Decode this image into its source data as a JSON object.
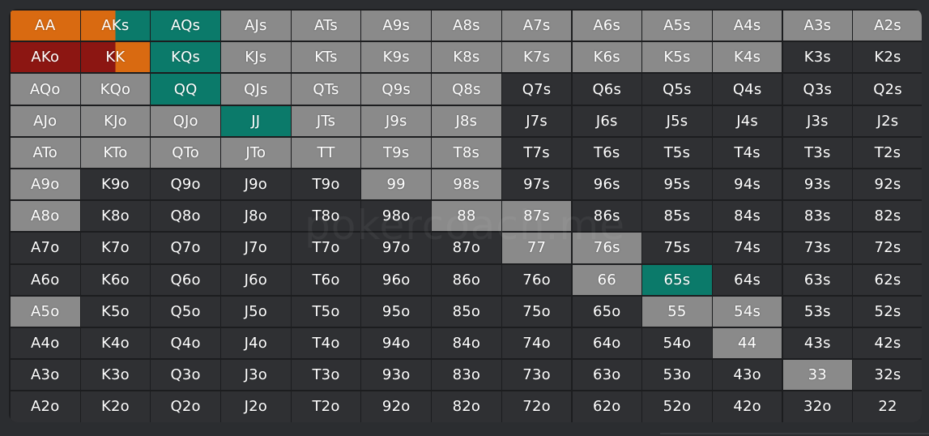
{
  "colors": {
    "background": "#2b2d30",
    "frame": "#1c1d1f",
    "dark": "#2f3033",
    "light": "#8a8a8a",
    "orange": "#d96a11",
    "dark_red": "#8c1612",
    "teal": "#0b7a6a"
  },
  "ranks": [
    "A",
    "K",
    "Q",
    "J",
    "T",
    "9",
    "8",
    "7",
    "6",
    "5",
    "4",
    "3",
    "2"
  ],
  "watermark": "pokercoach.me",
  "legend": {
    "L": "light",
    "D": "dark",
    "O": "orange",
    "R": "dark_red",
    "G": "teal",
    "LG": "light/teal split",
    "OG": "orange/teal split",
    "RO": "dark_red/orange split"
  },
  "grid": [
    [
      "O",
      "OG",
      "G",
      "L",
      "L",
      "L",
      "L",
      "L",
      "L",
      "L",
      "L",
      "L",
      "L"
    ],
    [
      "R",
      "RO",
      "G",
      "L",
      "L",
      "L",
      "L",
      "L",
      "L",
      "L",
      "L",
      "D",
      "D"
    ],
    [
      "L",
      "L",
      "G",
      "L",
      "L",
      "L",
      "L",
      "D",
      "D",
      "D",
      "D",
      "D",
      "D"
    ],
    [
      "L",
      "L",
      "L",
      "G",
      "L",
      "L",
      "L",
      "D",
      "D",
      "D",
      "D",
      "D",
      "D"
    ],
    [
      "L",
      "L",
      "L",
      "L",
      "L",
      "L",
      "L",
      "D",
      "D",
      "D",
      "D",
      "D",
      "D"
    ],
    [
      "L",
      "D",
      "D",
      "D",
      "D",
      "L",
      "L",
      "D",
      "D",
      "D",
      "D",
      "D",
      "D"
    ],
    [
      "L",
      "D",
      "D",
      "D",
      "D",
      "D",
      "L",
      "L",
      "D",
      "D",
      "D",
      "D",
      "D"
    ],
    [
      "D",
      "D",
      "D",
      "D",
      "D",
      "D",
      "D",
      "L",
      "L",
      "D",
      "D",
      "D",
      "D"
    ],
    [
      "D",
      "D",
      "D",
      "D",
      "D",
      "D",
      "D",
      "D",
      "L",
      "G",
      "D",
      "D",
      "D"
    ],
    [
      "L",
      "D",
      "D",
      "D",
      "D",
      "D",
      "D",
      "D",
      "D",
      "L",
      "L",
      "D",
      "D"
    ],
    [
      "D",
      "D",
      "D",
      "D",
      "D",
      "D",
      "D",
      "D",
      "D",
      "D",
      "L",
      "D",
      "D"
    ],
    [
      "D",
      "D",
      "D",
      "D",
      "D",
      "D",
      "D",
      "D",
      "D",
      "D",
      "D",
      "L",
      "D"
    ],
    [
      "D",
      "D",
      "D",
      "D",
      "D",
      "D",
      "D",
      "D",
      "D",
      "D",
      "D",
      "D",
      "D"
    ]
  ]
}
